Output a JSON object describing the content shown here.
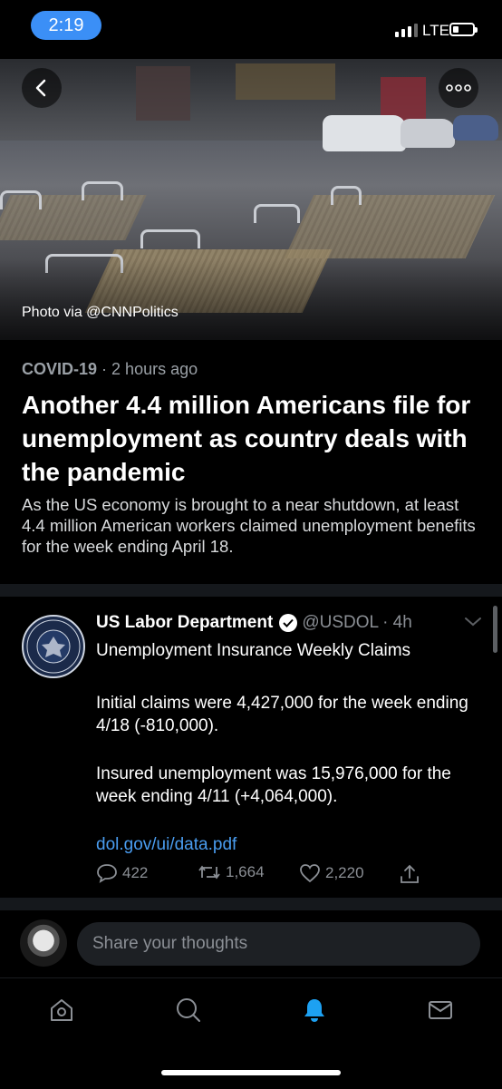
{
  "status_bar": {
    "time": "2:19",
    "network": "LTE",
    "battery_level": 0.25
  },
  "hero": {
    "photo_credit": "Photo via @CNNPolitics",
    "back_icon": "chevron-left-icon",
    "more_icon": "more-horizontal-icon"
  },
  "article": {
    "category": "COVID-19",
    "time_ago": "· 2 hours ago",
    "headline": "Another 4.4 million Americans file for unemployment as country deals with the pandemic",
    "summary": "As the US economy is brought to a near shutdown, at least 4.4 million American workers claimed unemployment benefits for the week ending April 18."
  },
  "tweet": {
    "author_name": "US Labor Department",
    "handle": "@USDOL",
    "time": "· 4h",
    "lines": [
      "Unemployment Insurance Weekly Claims",
      "Initial claims were 4,427,000 for the week ending 4/18 (-810,000).",
      "Insured unemployment was 15,976,000 for the week ending 4/11 (+4,064,000)."
    ],
    "link": "dol.gov/ui/data.pdf",
    "replies": "422",
    "retweets": "1,664",
    "likes": "2,220"
  },
  "composer": {
    "placeholder": "Share your thoughts"
  },
  "tabbar": {
    "tabs": [
      {
        "icon": "home-icon",
        "active": false
      },
      {
        "icon": "search-icon",
        "active": false
      },
      {
        "icon": "notifications-icon",
        "active": true
      },
      {
        "icon": "messages-icon",
        "active": false
      }
    ],
    "accent": "#1da1f2"
  },
  "colors": {
    "link": "#4a9df0",
    "time_pill": "#3b8ff6",
    "muted": "#8b8f95"
  }
}
